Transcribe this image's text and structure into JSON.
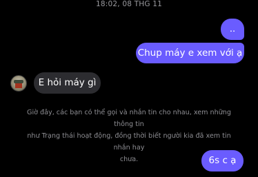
{
  "thread": {
    "timestamp": "18:02, 08 THG 11",
    "messages": [
      {
        "direction": "outgoing",
        "text": ".."
      },
      {
        "direction": "outgoing",
        "text": "Chup máy e xem với ạ"
      },
      {
        "direction": "incoming",
        "text": "E hỏi máy gì"
      },
      {
        "direction": "outgoing",
        "text": "6s c ạ"
      }
    ],
    "notice_lines": [
      "Giờ đây, các bạn có thể gọi và nhắn tin cho nhau, xem những thông tin",
      "như Trạng thái hoạt động, đồng thời biết người kia đã xem tin nhắn hay",
      "chưa."
    ]
  },
  "colors": {
    "background": "#000000",
    "outgoing_bubble": "#6a5cff",
    "incoming_bubble": "#2c2c30",
    "notice_text": "#8e8e93"
  }
}
